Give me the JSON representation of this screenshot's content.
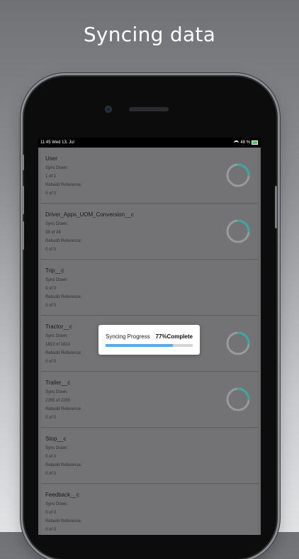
{
  "headline": "Syncing data",
  "status_bar": {
    "time_date": "11:45   Wed 13. Jul",
    "battery": "48 %"
  },
  "colors": {
    "ring": "#3aa89a",
    "progress_fill": "#5fa8e6",
    "screen_bg": "#6e6e70"
  },
  "sync_items": [
    {
      "name": "User",
      "sync_label": "Sync Down:",
      "sync_value": "1 of 1",
      "ref_label": "Rebuild Reference:",
      "ref_value": "0 of 0",
      "show_ring": true
    },
    {
      "name": "Driver_Apps_UOM_Conversion__c",
      "sync_label": "Sync Down:",
      "sync_value": "38 of 38",
      "ref_label": "Rebuild Reference:",
      "ref_value": "0 of 0",
      "show_ring": true
    },
    {
      "name": "Trip__c",
      "sync_label": "Sync Down:",
      "sync_value": "0 of 0",
      "ref_label": "Rebuild Reference:",
      "ref_value": "0 of 0",
      "show_ring": false
    },
    {
      "name": "Tractor__c",
      "sync_label": "Sync Down:",
      "sync_value": "1813 of 1813",
      "ref_label": "Rebuild Reference:",
      "ref_value": "0 of 0",
      "show_ring": true
    },
    {
      "name": "Trailer__c",
      "sync_label": "Sync Down:",
      "sync_value": "2265 of 2265",
      "ref_label": "Rebuild Reference:",
      "ref_value": "0 of 0",
      "show_ring": true
    },
    {
      "name": "Stop__c",
      "sync_label": "Sync Down:",
      "sync_value": "0 of 0",
      "ref_label": "Rebuild Reference:",
      "ref_value": "0 of 0",
      "show_ring": false
    },
    {
      "name": "Feedback__c",
      "sync_label": "Sync Down:",
      "sync_value": "0 of 0",
      "ref_label": "Rebuild Reference:",
      "ref_value": "0 of 0",
      "show_ring": false
    }
  ],
  "progress_dialog": {
    "label": "Syncing Progress",
    "percent_text": "77%Complete",
    "progress": 0.77
  }
}
